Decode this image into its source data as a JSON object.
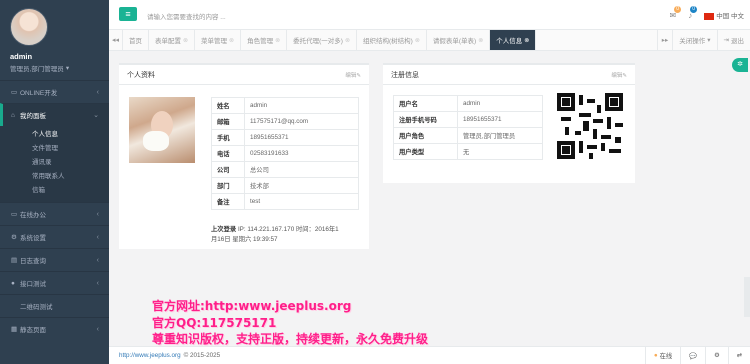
{
  "user": {
    "name": "admin",
    "role": "管理员,部门管理员"
  },
  "sidebar": {
    "items": [
      {
        "label": "ONLINE开发",
        "icon": "monitor-icon"
      },
      {
        "label": "我的面板",
        "icon": "home-icon",
        "active": true
      },
      {
        "label": "在线办公",
        "icon": "desktop-icon"
      },
      {
        "label": "系统设置",
        "icon": "gear-icon"
      },
      {
        "label": "日志查询",
        "icon": "log-icon"
      },
      {
        "label": "接口测试",
        "icon": "api-icon"
      },
      {
        "label": "二维码测试",
        "icon": "qrcode-icon"
      },
      {
        "label": "静态页面",
        "icon": "page-icon"
      }
    ],
    "sub": [
      "个人信息",
      "文件管理",
      "通讯录",
      "常用联系人",
      "信箱"
    ]
  },
  "topbar": {
    "search_placeholder": "请输入您需要查找的内容 ...",
    "mail_count": "0",
    "bell_count": "0",
    "lang": "中国 中文"
  },
  "tabs": {
    "items": [
      "首页",
      "表单配置",
      "菜单管理",
      "角色管理",
      "委托代理(一对多)",
      "组织结构(树结构)",
      "请假表单(单表)",
      "个人信息"
    ],
    "close_ops": "关闭操作",
    "logout": "退出"
  },
  "profile_panel": {
    "title": "个人资料",
    "edit": "编辑",
    "rows": [
      {
        "k": "姓名",
        "v": "admin"
      },
      {
        "k": "邮箱",
        "v": "117575171@qq.com"
      },
      {
        "k": "手机",
        "v": "18951655371"
      },
      {
        "k": "电话",
        "v": "02583191633"
      },
      {
        "k": "公司",
        "v": "总公司"
      },
      {
        "k": "部门",
        "v": "技术部"
      },
      {
        "k": "备注",
        "v": "test"
      }
    ],
    "last_login_label": "上次登录",
    "last_login_value": "IP: 114.221.167.170  时间：2016年1月16日 星期六 19:39:57"
  },
  "reg_panel": {
    "title": "注册信息",
    "edit": "编辑",
    "rows": [
      {
        "k": "用户名",
        "v": "admin"
      },
      {
        "k": "注册手机号码",
        "v": "18951655371"
      },
      {
        "k": "用户角色",
        "v": "管理员,部门管理员"
      },
      {
        "k": "用户类型",
        "v": "无"
      }
    ]
  },
  "footer": {
    "link": "http://www.jeeplus.org",
    "copy": "© 2015-2025",
    "online": "在线"
  },
  "watermark": {
    "line1": "官方网址:http:www.jeeplus.org",
    "line2": "官方QQ:117575171",
    "line3": "尊重知识版权，支持正版，持续更新，永久免费升级"
  },
  "colors": {
    "sidebar": "#2f4050",
    "accent": "#1ab394",
    "watermark": "#ff1f8a"
  }
}
